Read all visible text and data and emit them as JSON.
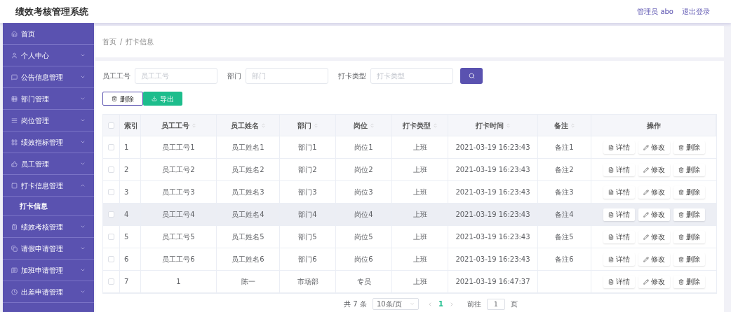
{
  "header": {
    "title": "绩效考核管理系统",
    "user": "管理员 abo",
    "logout": "退出登录"
  },
  "sidebar": {
    "items": [
      {
        "label": "首页"
      },
      {
        "label": "个人中心",
        "expanded": false
      },
      {
        "label": "公告信息管理",
        "expanded": false
      },
      {
        "label": "部门管理",
        "expanded": false
      },
      {
        "label": "岗位管理",
        "expanded": false
      },
      {
        "label": "绩效指标管理",
        "expanded": false
      },
      {
        "label": "员工管理",
        "expanded": false
      },
      {
        "label": "打卡信息管理",
        "expanded": true,
        "children": [
          {
            "label": "打卡信息"
          }
        ]
      },
      {
        "label": "绩效考核管理",
        "expanded": false
      },
      {
        "label": "请假申请管理",
        "expanded": false
      },
      {
        "label": "加班申请管理",
        "expanded": false
      },
      {
        "label": "出差申请管理",
        "expanded": false
      }
    ]
  },
  "breadcrumb": [
    "首页",
    "/",
    "打卡信息"
  ],
  "filters": [
    {
      "label": "员工工号",
      "placeholder": "员工工号"
    },
    {
      "label": "部门",
      "placeholder": "部门"
    },
    {
      "label": "打卡类型",
      "placeholder": "打卡类型"
    }
  ],
  "actions": [
    {
      "label": "删除",
      "kind": "outline"
    },
    {
      "label": "导出",
      "kind": "export"
    }
  ],
  "table": {
    "header_checked": false,
    "columns": [
      {
        "label": "索引",
        "sortable": false
      },
      {
        "label": "员工工号",
        "sortable": true
      },
      {
        "label": "员工姓名",
        "sortable": true
      },
      {
        "label": "部门",
        "sortable": true
      },
      {
        "label": "岗位",
        "sortable": true
      },
      {
        "label": "打卡类型",
        "sortable": true
      },
      {
        "label": "打卡时间",
        "sortable": true
      },
      {
        "label": "备注",
        "sortable": true
      },
      {
        "label": "操作",
        "sortable": false
      }
    ],
    "rows": [
      {
        "checked": false,
        "highlighted": false,
        "cells": [
          "1",
          "员工工号1",
          "员工姓名1",
          "部门1",
          "岗位1",
          "上班",
          "2021-03-19 16:23:43",
          "备注1"
        ],
        "actions": [
          "详情",
          "修改",
          "删除"
        ]
      },
      {
        "checked": false,
        "highlighted": false,
        "cells": [
          "2",
          "员工工号2",
          "员工姓名2",
          "部门2",
          "岗位2",
          "上班",
          "2021-03-19 16:23:43",
          "备注2"
        ],
        "actions": [
          "详情",
          "修改",
          "删除"
        ]
      },
      {
        "checked": false,
        "highlighted": false,
        "cells": [
          "3",
          "员工工号3",
          "员工姓名3",
          "部门3",
          "岗位3",
          "上班",
          "2021-03-19 16:23:43",
          "备注3"
        ],
        "actions": [
          "详情",
          "修改",
          "删除"
        ]
      },
      {
        "checked": false,
        "highlighted": true,
        "cells": [
          "4",
          "员工工号4",
          "员工姓名4",
          "部门4",
          "岗位4",
          "上班",
          "2021-03-19 16:23:43",
          "备注4"
        ],
        "actions": [
          "详情",
          "修改",
          "删除"
        ]
      },
      {
        "checked": false,
        "highlighted": false,
        "cells": [
          "5",
          "员工工号5",
          "员工姓名5",
          "部门5",
          "岗位5",
          "上班",
          "2021-03-19 16:23:43",
          "备注5"
        ],
        "actions": [
          "详情",
          "修改",
          "删除"
        ]
      },
      {
        "checked": false,
        "highlighted": false,
        "cells": [
          "6",
          "员工工号6",
          "员工姓名6",
          "部门6",
          "岗位6",
          "上班",
          "2021-03-19 16:23:43",
          "备注6"
        ],
        "actions": [
          "详情",
          "修改",
          "删除"
        ]
      },
      {
        "checked": false,
        "highlighted": false,
        "cells": [
          "7",
          "1",
          "陈一",
          "市场部",
          "专员",
          "上班",
          "2021-03-19 16:47:37",
          ""
        ],
        "actions": [
          "详情",
          "修改",
          "删除"
        ]
      }
    ]
  },
  "pagination": {
    "total": "共 7 条",
    "page_size": "10条/页",
    "pages": [
      {
        "label": "1",
        "selected": true
      }
    ],
    "goto": "前往",
    "goto_value": "1",
    "goto_suffix": "页"
  }
}
